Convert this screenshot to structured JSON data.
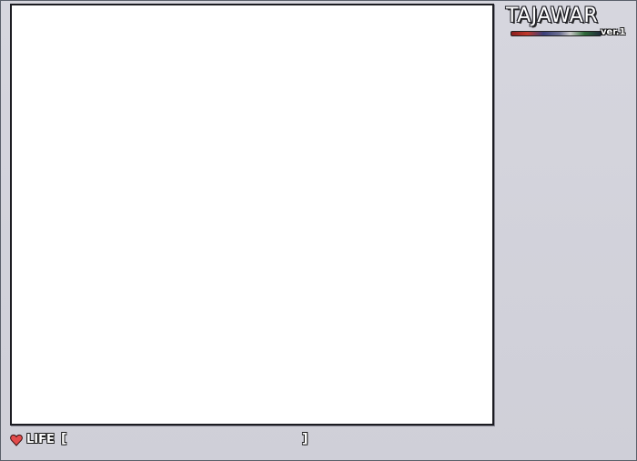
{
  "logo": {
    "title": "TAJAWAR",
    "version": "ver.1"
  },
  "status": {
    "heart_icon": "heart-icon",
    "life_label": "LIFE",
    "bracket_open": "[",
    "bracket_close": "]",
    "life_fraction": 0
  },
  "colors": {
    "background": "#d0d0d8",
    "playfield": "#ffffff",
    "heart": "#e24b4b"
  }
}
